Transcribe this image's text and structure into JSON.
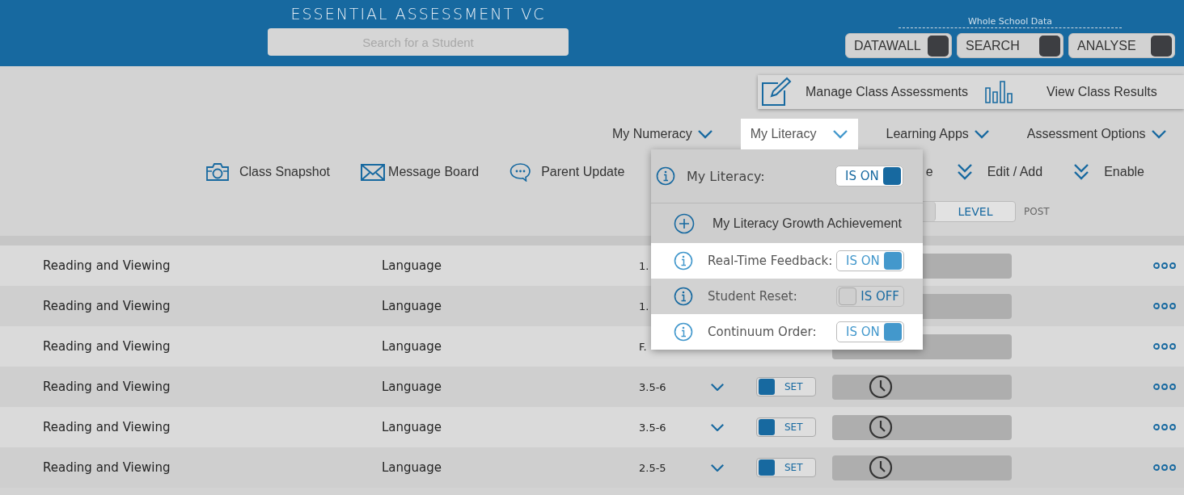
{
  "header": {
    "title": "ESSENTIAL ASSESSMENT VC",
    "search": {
      "placeholder": "Search for a Student"
    },
    "whole_school_label": "Whole School Data",
    "switches": [
      {
        "label": "DATAWALL",
        "on": false
      },
      {
        "label": "SEARCH",
        "on": false
      },
      {
        "label": "ANALYSE",
        "on": false
      }
    ]
  },
  "class_panel": [
    {
      "kind": "pencil",
      "label": "Manage Class Assessments"
    },
    {
      "kind": "chart",
      "label": "View Class Results"
    }
  ],
  "nav": [
    {
      "label": "My Numeracy",
      "selected": false
    },
    {
      "label": "My Literacy",
      "selected": true
    },
    {
      "label": "Learning Apps",
      "selected": false
    },
    {
      "label": "Assessment Options",
      "selected": false
    }
  ],
  "toolbar_left": [
    {
      "kind": "camera",
      "label": "Class Snapshot"
    },
    {
      "kind": "mail",
      "label": "Message Board"
    },
    {
      "kind": "chat",
      "label": "Parent Update"
    }
  ],
  "toolbar_right": [
    {
      "kind": "none",
      "label": "e"
    },
    {
      "kind": "chevrons",
      "label": "Edit / Add"
    },
    {
      "kind": "chevrons",
      "label": "Enable"
    }
  ],
  "mode_toggle": {
    "segments": [
      {
        "label": "LEVEL",
        "selected": false
      }
    ],
    "post_label": "POST"
  },
  "rows": [
    {
      "subject": "Reading and Viewing",
      "strand": "Language",
      "level": "1."
    },
    {
      "subject": "Reading and Viewing",
      "strand": "Language",
      "level": "1."
    },
    {
      "subject": "Reading and Viewing",
      "strand": "Language",
      "level": "F."
    },
    {
      "subject": "Reading and Viewing",
      "strand": "Language",
      "level": "3.5-6",
      "set": {
        "label": "SET",
        "on": true
      }
    },
    {
      "subject": "Reading and Viewing",
      "strand": "Language",
      "level": "3.5-6",
      "set": {
        "label": "SET",
        "on": true
      }
    },
    {
      "subject": "Reading and Viewing",
      "strand": "Language",
      "level": "2.5-5",
      "set": {
        "label": "SET",
        "on": true
      }
    }
  ],
  "dropdown": {
    "header": {
      "label": "My Literacy:",
      "state": "IS ON",
      "on": true
    },
    "growth": {
      "label": "My Literacy Growth Achievement"
    },
    "settings": [
      {
        "label": "Real-Time Feedback:",
        "state": "IS ON",
        "on": true
      },
      {
        "label": "Student Reset:",
        "state": "IS OFF",
        "on": false
      },
      {
        "label": "Continuum Order:",
        "state": "IS ON",
        "on": true
      }
    ]
  }
}
